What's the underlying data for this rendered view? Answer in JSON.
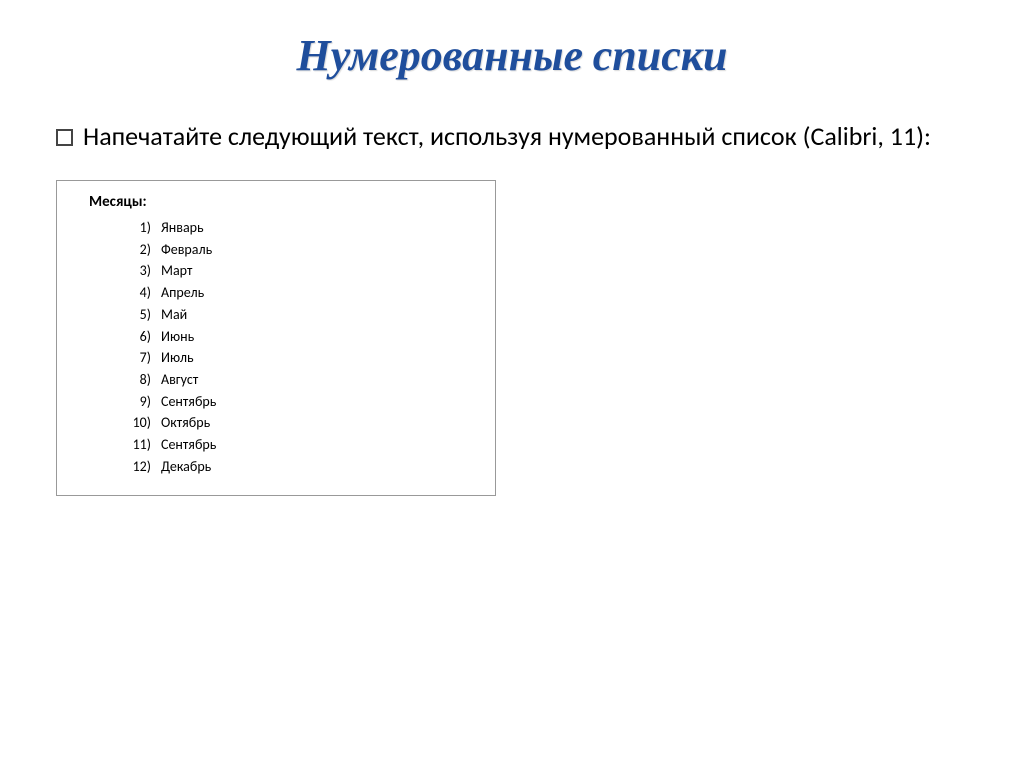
{
  "title": "Нумерованные списки",
  "instruction": "Напечатайте следующий текст, используя нумерованный список (Calibri, 11):",
  "box": {
    "heading": "Месяцы:",
    "items": [
      {
        "num": "1)",
        "label": "Январь"
      },
      {
        "num": "2)",
        "label": "Февраль"
      },
      {
        "num": "3)",
        "label": "Март"
      },
      {
        "num": "4)",
        "label": "Апрель"
      },
      {
        "num": "5)",
        "label": "Май"
      },
      {
        "num": "6)",
        "label": "Июнь"
      },
      {
        "num": "7)",
        "label": "Июль"
      },
      {
        "num": "8)",
        "label": "Август"
      },
      {
        "num": "9)",
        "label": "Сентябрь"
      },
      {
        "num": "10)",
        "label": "Октябрь"
      },
      {
        "num": "11)",
        "label": "Сентябрь"
      },
      {
        "num": "12)",
        "label": "Декабрь"
      }
    ]
  }
}
